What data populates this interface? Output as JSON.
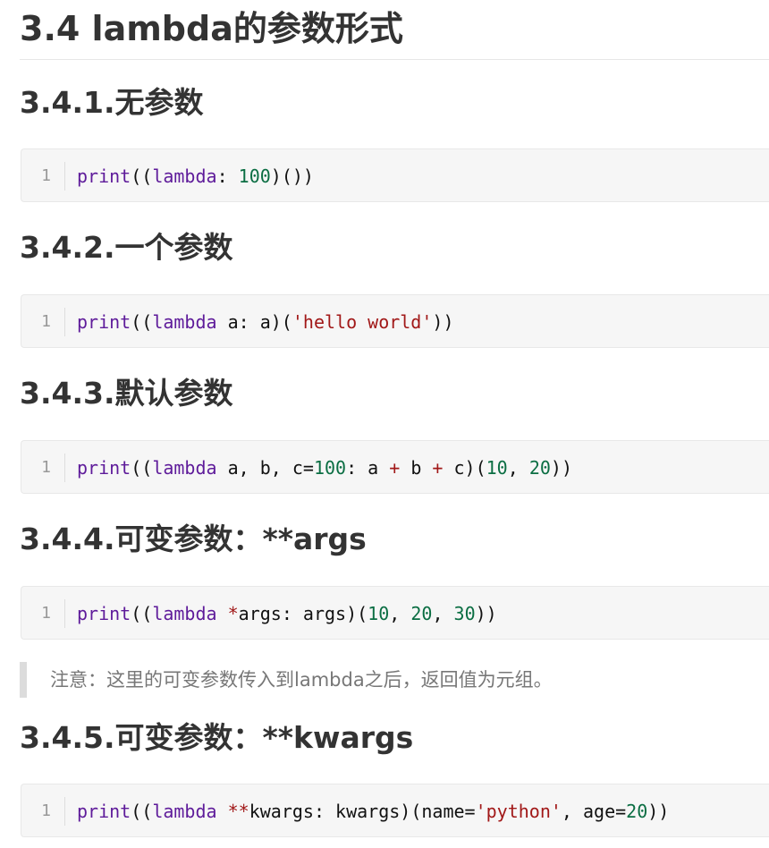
{
  "main_heading": "3.4 lambda的参数形式",
  "sections": [
    {
      "heading": "3.4.1.无参数",
      "line_number": "1",
      "code": [
        {
          "t": "print",
          "c": "fn"
        },
        {
          "t": "((",
          "c": "plain"
        },
        {
          "t": "lambda",
          "c": "kw"
        },
        {
          "t": ": ",
          "c": "plain"
        },
        {
          "t": "100",
          "c": "num"
        },
        {
          "t": ")())",
          "c": "plain"
        }
      ]
    },
    {
      "heading": "3.4.2.一个参数",
      "line_number": "1",
      "code": [
        {
          "t": "print",
          "c": "fn"
        },
        {
          "t": "((",
          "c": "plain"
        },
        {
          "t": "lambda",
          "c": "kw"
        },
        {
          "t": " a: a)(",
          "c": "plain"
        },
        {
          "t": "'hello world'",
          "c": "str"
        },
        {
          "t": "))",
          "c": "plain"
        }
      ]
    },
    {
      "heading": "3.4.3.默认参数",
      "line_number": "1",
      "code": [
        {
          "t": "print",
          "c": "fn"
        },
        {
          "t": "((",
          "c": "plain"
        },
        {
          "t": "lambda",
          "c": "kw"
        },
        {
          "t": " a, b, c=",
          "c": "plain"
        },
        {
          "t": "100",
          "c": "num"
        },
        {
          "t": ": a ",
          "c": "plain"
        },
        {
          "t": "+",
          "c": "op"
        },
        {
          "t": " b ",
          "c": "plain"
        },
        {
          "t": "+",
          "c": "op"
        },
        {
          "t": " c)(",
          "c": "plain"
        },
        {
          "t": "10",
          "c": "num"
        },
        {
          "t": ", ",
          "c": "plain"
        },
        {
          "t": "20",
          "c": "num"
        },
        {
          "t": "))",
          "c": "plain"
        }
      ]
    },
    {
      "heading": "3.4.4.可变参数：**args",
      "line_number": "1",
      "code": [
        {
          "t": "print",
          "c": "fn"
        },
        {
          "t": "((",
          "c": "plain"
        },
        {
          "t": "lambda",
          "c": "kw"
        },
        {
          "t": " ",
          "c": "plain"
        },
        {
          "t": "*",
          "c": "op"
        },
        {
          "t": "args: args)(",
          "c": "plain"
        },
        {
          "t": "10",
          "c": "num"
        },
        {
          "t": ", ",
          "c": "plain"
        },
        {
          "t": "20",
          "c": "num"
        },
        {
          "t": ", ",
          "c": "plain"
        },
        {
          "t": "30",
          "c": "num"
        },
        {
          "t": "))",
          "c": "plain"
        }
      ]
    },
    {
      "heading": "3.4.5.可变参数：**kwargs",
      "line_number": "1",
      "code": [
        {
          "t": "print",
          "c": "fn"
        },
        {
          "t": "((",
          "c": "plain"
        },
        {
          "t": "lambda",
          "c": "kw"
        },
        {
          "t": " ",
          "c": "plain"
        },
        {
          "t": "**",
          "c": "op"
        },
        {
          "t": "kwargs: kwargs)(name=",
          "c": "plain"
        },
        {
          "t": "'python'",
          "c": "str"
        },
        {
          "t": ", age=",
          "c": "plain"
        },
        {
          "t": "20",
          "c": "num"
        },
        {
          "t": "))",
          "c": "plain"
        }
      ]
    }
  ],
  "note": "注意：这里的可变参数传入到lambda之后，返回值为元组。"
}
